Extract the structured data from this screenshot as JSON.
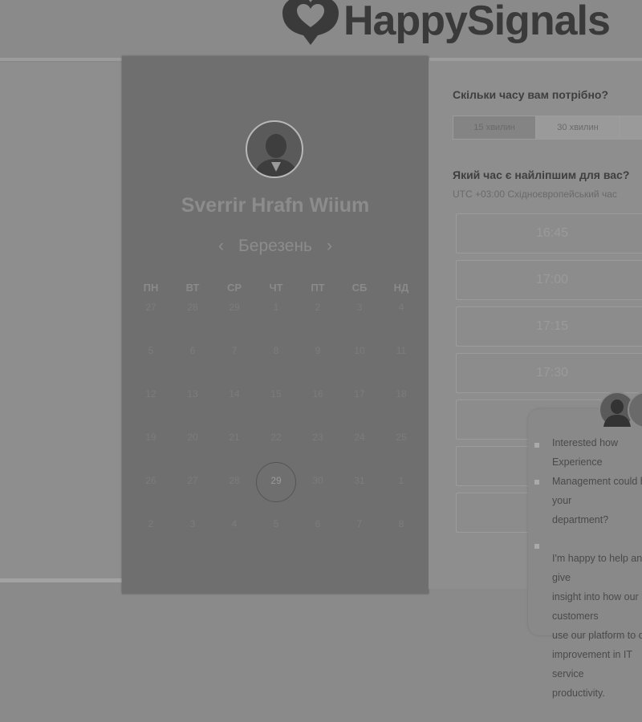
{
  "brand": {
    "name": "HappySignals"
  },
  "calendar": {
    "host_name": "Sverrir Hrafn Wiium",
    "month": "Березень",
    "prev_icon": "chevron-left-icon",
    "next_icon": "chevron-right-icon",
    "weekdays": [
      "ПН",
      "ВТ",
      "СР",
      "ЧТ",
      "ПТ",
      "СБ",
      "НД"
    ],
    "weeks": [
      [
        "27",
        "28",
        "29",
        "1",
        "2",
        "3",
        "4"
      ],
      [
        "5",
        "6",
        "7",
        "8",
        "9",
        "10",
        "11"
      ],
      [
        "12",
        "13",
        "14",
        "15",
        "16",
        "17",
        "18"
      ],
      [
        "19",
        "20",
        "21",
        "22",
        "23",
        "24",
        "25"
      ],
      [
        "26",
        "27",
        "28",
        "29",
        "30",
        "31",
        "1"
      ],
      [
        "2",
        "3",
        "4",
        "5",
        "6",
        "7",
        "8"
      ]
    ],
    "selected_day": "29"
  },
  "booking": {
    "duration_question": "Скільки часу вам потрібно?",
    "durations": [
      "15 хвилин",
      "30 хвилин"
    ],
    "time_question": "Який час є найліпшим для вас?",
    "timezone": "UTC +03:00 Східноєвропейський час",
    "slots": [
      "16:45",
      "17:00",
      "17:15",
      "17:30",
      "",
      "",
      ""
    ]
  },
  "chat": {
    "message": "Interested how Experience\nManagement could help your\ndepartment?\n\nI'm happy to help and give\ninsight into how our customers\nuse our platform to drive\nimprovement in IT service\nproductivity."
  }
}
